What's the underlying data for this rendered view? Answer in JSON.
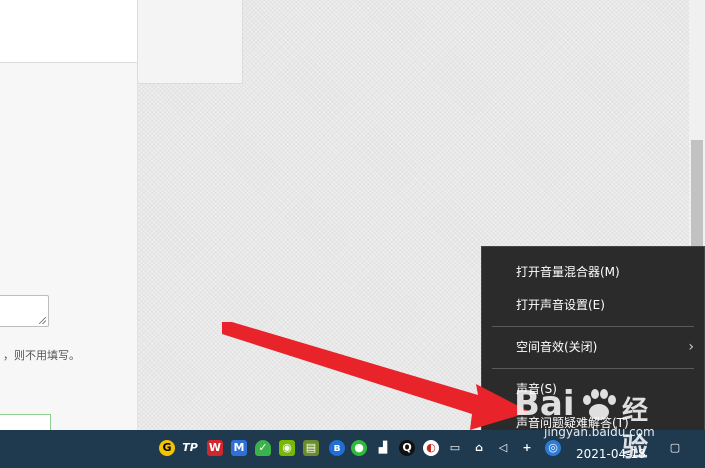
{
  "page": {
    "hint_text": "，则不用填写。"
  },
  "context_menu": {
    "items": [
      {
        "label": "打开音量混合器(M)"
      },
      {
        "label": "打开声音设置(E)"
      },
      {
        "label": "空间音效(关闭)",
        "has_submenu": true
      },
      {
        "label": "声音(S)"
      },
      {
        "label": "声音问题疑难解答(T)"
      }
    ]
  },
  "taskbar": {
    "clock_date": "2021-04-18",
    "tray_icons": [
      "g-app-icon",
      "tp-app-icon",
      "wps-icon",
      "security-icon",
      "shield-icon",
      "nvidia-icon",
      "monitor-icon",
      "bluetooth-icon",
      "wechat-icon",
      "bookmark-icon",
      "qq-icon",
      "browser-icon",
      "device-icon",
      "wifi-icon",
      "volume-icon",
      "network-icon",
      "search-icon",
      "notification-icon"
    ]
  },
  "watermark": {
    "logo_text": "Bai",
    "brand_cn": "经验",
    "url": "jingyan.baidu.com"
  },
  "colors": {
    "menu_bg": "#2b2b2b",
    "taskbar_bg": "#1f3a4f",
    "arrow": "#e8232a"
  }
}
